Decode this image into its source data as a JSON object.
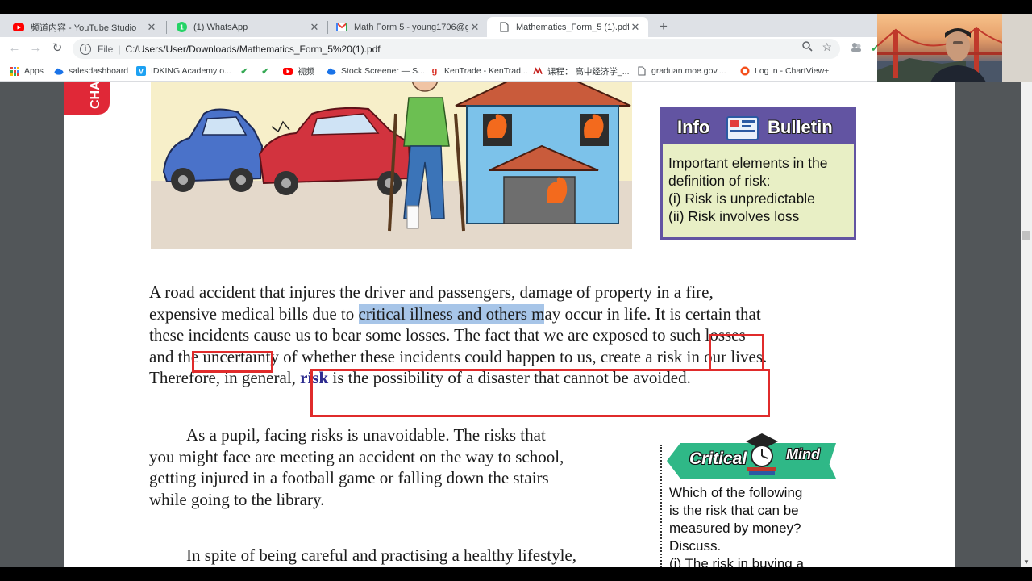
{
  "browser": {
    "tabs": [
      {
        "title": "频道内容 - YouTube Studio",
        "icon": "youtube-icon",
        "color": "#ff0000"
      },
      {
        "title": "(1) WhatsApp",
        "icon": "whatsapp-icon",
        "color": "#25d366"
      },
      {
        "title": "Math Form 5 - young1706@gma",
        "icon": "gmail-icon",
        "color": "#ea4335"
      },
      {
        "title": "Mathematics_Form_5 (1).pdf",
        "icon": "document-icon",
        "color": "#5f6368",
        "active": true
      }
    ],
    "address": {
      "scheme": "File",
      "url": "C:/Users/User/Downloads/Mathematics_Form_5%20(1).pdf"
    },
    "bookmarks": [
      {
        "label": "Apps",
        "icon": "apps-grid-icon"
      },
      {
        "label": "salesdashboard",
        "icon": "cloud-icon"
      },
      {
        "label": "IDKING Academy o...",
        "icon": "v-logo-icon"
      },
      {
        "label": "",
        "icon": "checkmark-icon"
      },
      {
        "label": "",
        "icon": "checkmark-icon"
      },
      {
        "label": "视频",
        "icon": "youtube-icon"
      },
      {
        "label": "Stock Screener — S...",
        "icon": "cloud-icon"
      },
      {
        "label": "KenTrade - KenTrad...",
        "icon": "g-logo-icon"
      },
      {
        "label": "课程： 高中经济学_...",
        "icon": "mooc-icon"
      },
      {
        "label": "graduan.moe.gov....",
        "icon": "page-icon"
      },
      {
        "label": "Log in - ChartView+",
        "icon": "chartview-icon"
      }
    ]
  },
  "document": {
    "chapter_tab": "CHA",
    "info_bulletin": {
      "heading_left": "Info",
      "heading_right": "Bulletin",
      "lines": [
        "Important elements in the",
        "definition of risk:",
        "(i)  Risk is unpredictable",
        "(ii)  Risk involves loss"
      ]
    },
    "paragraph1": {
      "line1": "A road accident that injures the driver and passengers, damage of property in a fire,",
      "line2_before": "expensive medical bills due to ",
      "line2_highlight": "critical illness and others m",
      "line2_after": "ay occur in life. It is certain that",
      "line3": "these incidents cause us to bear some losses. The fact that we are exposed to such losses",
      "line4": "and the uncertainty of whether these incidents could happen to us, create a risk in our lives.",
      "line5_before": "Therefore, in general, ",
      "line5_keyword": "risk",
      "line5_after": " is the possibility of a disaster that cannot be avoided."
    },
    "paragraph2": [
      "As a pupil, facing risks is unavoidable. The risks that",
      "you might face are meeting an accident on the way to school,",
      "getting injured in a football game or falling down the stairs",
      "while going to the library."
    ],
    "paragraph3": "In spite of being careful and practising a healthy lifestyle,",
    "critical_mind": {
      "word1": "Critical",
      "word2": "Mind",
      "lines": [
        "Which of the following",
        "is the risk that can be",
        "measured by money?",
        "Discuss.",
        "(i)   The risk in buying a"
      ]
    }
  }
}
